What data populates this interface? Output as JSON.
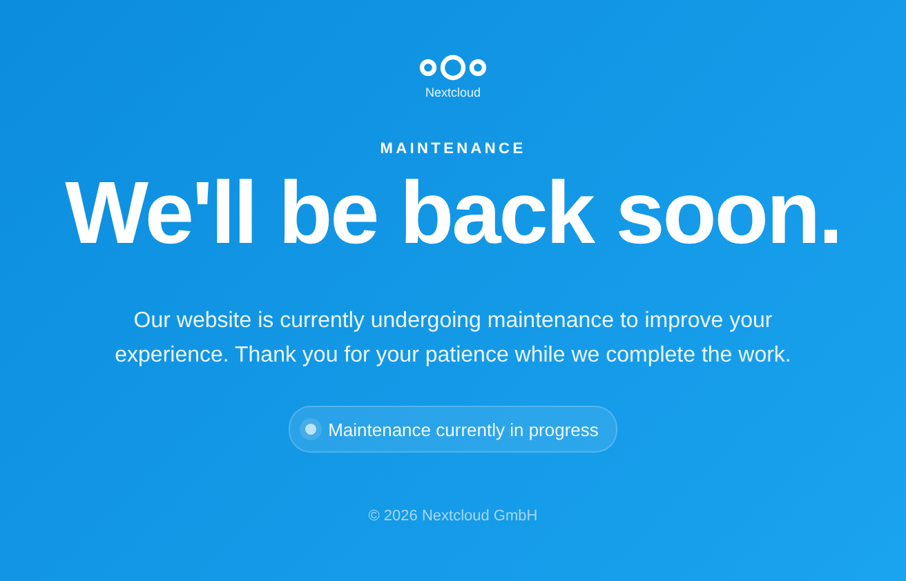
{
  "logo": {
    "name": "Nextcloud"
  },
  "eyebrow": "MAINTENANCE",
  "headline": "We'll be back soon.",
  "message": "Our website is currently undergoing maintenance to improve your experience. Thank you for your patience while we complete the work.",
  "status": {
    "label": "Maintenance currently in progress"
  },
  "footer": "© 2026 Nextcloud GmbH"
}
